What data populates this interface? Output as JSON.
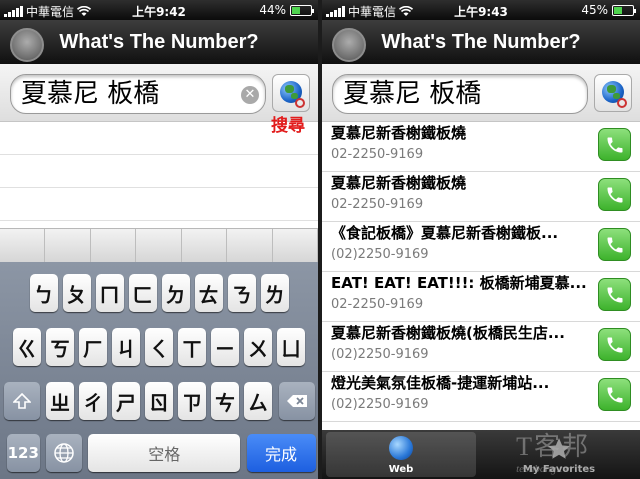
{
  "left": {
    "status": {
      "carrier": "中華電信",
      "time": "上午9:42",
      "battery_pct": "44%",
      "battery_fill": 0.44
    },
    "nav_title": "What's The Number?",
    "search_value": "夏慕尼 板橋",
    "search_button_label": "搜尋",
    "keyboard": {
      "row1": [
        "ㄅ",
        "ㄆ",
        "ㄇ",
        "ㄈ",
        "ㄉ",
        "ㄊ",
        "ㄋ",
        "ㄌ"
      ],
      "row2": [
        "ㄍ",
        "ㄎ",
        "ㄏ",
        "ㄐ",
        "ㄑ",
        "ㄒ",
        "ㄧ",
        "ㄨ",
        "ㄩ"
      ],
      "row3": [
        "ㄓ",
        "ㄔ",
        "ㄕ",
        "ㄖ",
        "ㄗ",
        "ㄘ",
        "ㄙ"
      ],
      "k123": "123",
      "space": "空格",
      "done": "完成"
    }
  },
  "right": {
    "status": {
      "carrier": "中華電信",
      "time": "上午9:43",
      "battery_pct": "45%",
      "battery_fill": 0.45
    },
    "nav_title": "What's The Number?",
    "search_value": "夏慕尼 板橋",
    "results": [
      {
        "name": "夏慕尼新香榭鐵板燒",
        "phone": "02-2250-9169"
      },
      {
        "name": "夏慕尼新香榭鐵板燒",
        "phone": "02-2250-9169"
      },
      {
        "name": "《食記板橋》夏慕尼新香榭鐵板...",
        "phone": "(02)2250-9169"
      },
      {
        "name": "EAT! EAT! EAT!!!: 板橋新埔夏慕...",
        "phone": "02-2250-9169"
      },
      {
        "name": "夏慕尼新香榭鐵板燒(板橋民生店...",
        "phone": "(02)2250-9169"
      },
      {
        "name": "燈光美氣氛佳板橋-捷運新埔站...",
        "phone": "(02)2250-9169"
      }
    ],
    "tabs": {
      "web": "Web",
      "favorites": "My Favorites"
    },
    "watermark": {
      "big": "T客邦",
      "small": "techbang.tw"
    }
  }
}
